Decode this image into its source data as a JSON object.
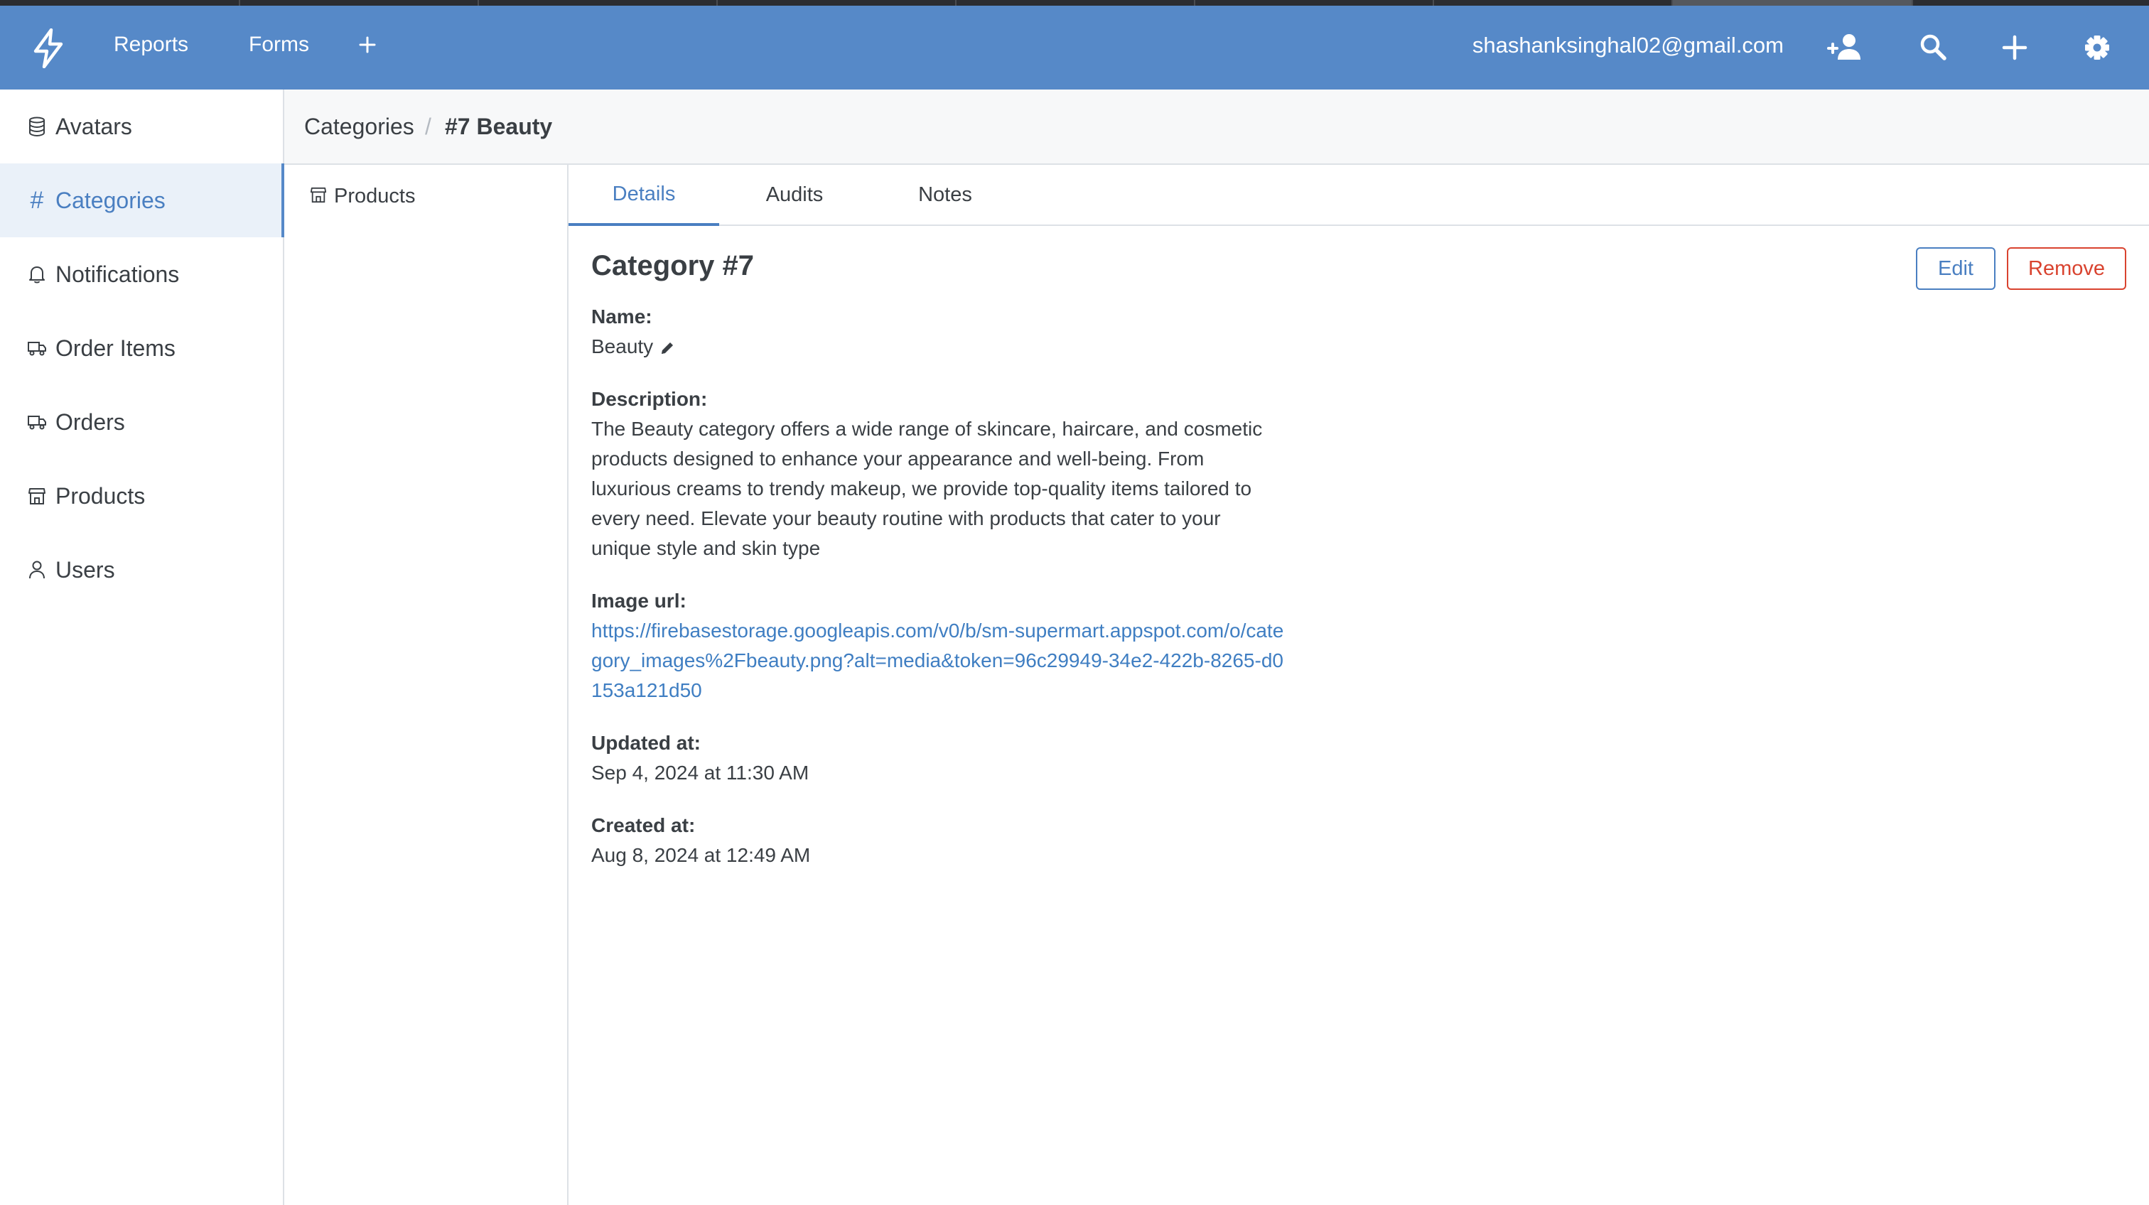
{
  "header": {
    "nav": {
      "reports": "Reports",
      "forms": "Forms"
    },
    "user_email": "shashanksinghal02@gmail.com",
    "icons": [
      "bolt-logo-icon",
      "plus-icon",
      "add-user-icon",
      "search-icon",
      "plus-icon",
      "gear-icon"
    ]
  },
  "sidebar": {
    "items": [
      {
        "label": "Avatars",
        "icon": "database-icon"
      },
      {
        "label": "Categories",
        "icon": "hash-icon",
        "active": true
      },
      {
        "label": "Notifications",
        "icon": "bell-icon"
      },
      {
        "label": "Order Items",
        "icon": "truck-icon"
      },
      {
        "label": "Orders",
        "icon": "truck-icon"
      },
      {
        "label": "Products",
        "icon": "store-icon"
      },
      {
        "label": "Users",
        "icon": "user-icon"
      }
    ]
  },
  "breadcrumb": {
    "parent": "Categories",
    "separator": "/",
    "current": "#7 Beauty"
  },
  "sublist": {
    "items": [
      {
        "label": "Products",
        "icon": "store-icon"
      }
    ]
  },
  "tabs": [
    {
      "label": "Details",
      "active": true
    },
    {
      "label": "Audits"
    },
    {
      "label": "Notes"
    }
  ],
  "detail": {
    "title": "Category #7",
    "name_label": "Name:",
    "name_value": "Beauty",
    "description_label": "Description:",
    "description_value": "The Beauty category offers a wide range of skincare, haircare, and cosmetic products designed to enhance your appearance and well-being. From luxurious creams to trendy makeup, we provide top-quality items tailored to every need. Elevate your beauty routine with products that cater to your unique style and skin type",
    "image_url_label": "Image url:",
    "image_url_value": "https://firebasestorage.googleapis.com/v0/b/sm-supermart.appspot.com/o/category_images%2Fbeauty.png?alt=media&token=96c29949-34e2-422b-8265-d0153a121d50",
    "updated_label": "Updated at:",
    "updated_value": "Sep 4, 2024 at 11:30 AM",
    "created_label": "Created at:",
    "created_value": "Aug 8, 2024 at 12:49 AM"
  },
  "actions": {
    "edit": "Edit",
    "remove": "Remove"
  },
  "colors": {
    "header": "#5689c8",
    "accent": "#4a7fc1",
    "danger": "#d9432f",
    "link": "#3f7ec2"
  }
}
